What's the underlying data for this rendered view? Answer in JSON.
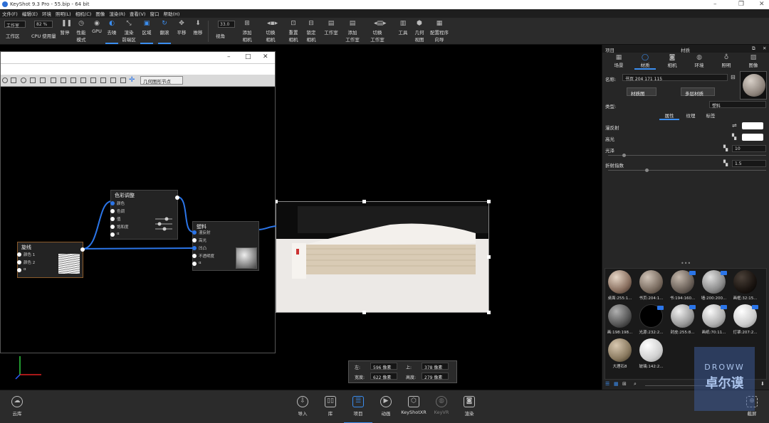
{
  "window": {
    "title": "KeyShot 9.3 Pro  -  55.bip  -  64 bit"
  },
  "menu": [
    "文件(F)",
    "编辑(E)",
    "环境",
    "照明(L)",
    "相机(C)",
    "图像",
    "渲染(R)",
    "查看(V)",
    "窗口",
    "帮助(H)"
  ],
  "toolbar": {
    "workspace_value": "工作室",
    "workspace_label": "工作区",
    "cpu_value": "82 %",
    "cpu_label": "CPU 使用量",
    "pause": "暂停",
    "perf_mode": "性能\n模式",
    "gpu": "GPU",
    "denoise": "去噪",
    "region": "渲染\n前端区",
    "area": "区域",
    "tumble": "翻滚",
    "pan": "平移",
    "dolly": "推移",
    "fov_value": "33.0",
    "perspective": "视角",
    "add_camera": "添加\n相机",
    "switch_camera": "切换\n相机",
    "reset_camera": "重置\n相机",
    "lock_camera": "锁定\n相机",
    "studio": "工作室",
    "add_studio": "添加\n工作室",
    "switch_studio": "切换\n工作室",
    "tools": "工具",
    "geometry_view": "几何\n视图",
    "configurator": "配置程序\n向导"
  },
  "graph": {
    "node_button": "几何图形节点",
    "nodes": {
      "color_adjust": {
        "title": "色彩调整",
        "ports": [
          "颜色",
          "色调",
          "值",
          "饱和度",
          "α"
        ]
      },
      "cloud": {
        "title": "旋线",
        "ports": [
          "颜色 1",
          "颜色 2",
          "α"
        ]
      },
      "plastic": {
        "title": "塑料",
        "ports": [
          "漫反射",
          "高光",
          "凹凸",
          "不透明度",
          "α"
        ]
      }
    }
  },
  "info": {
    "left_label": "左:",
    "left_value": "596 像素",
    "top_label": "上:",
    "top_value": "378 像素",
    "width_label": "宽度:",
    "width_value": "622 像素",
    "height_label": "高度:",
    "height_value": "279 像素"
  },
  "panel": {
    "project": "项目",
    "material": "材质",
    "tabs": [
      "场景",
      "材质",
      "相机",
      "环境",
      "照明",
      "图像"
    ],
    "name_label": "名称:",
    "name_value": "书页 204 171 115",
    "material_graph_button": "材质图",
    "multilayer_button": "多层材质",
    "type_label": "类型:",
    "type_value": "塑料",
    "subtabs": [
      "属性",
      "纹理",
      "标签"
    ],
    "diffuse": "漫反射",
    "specular": "高光",
    "roughness": "光泽",
    "roughness_value": "10",
    "refraction": "折射指数",
    "refraction_value": "1.5"
  },
  "library": [
    {
      "label": "桌面:255:1..."
    },
    {
      "label": "书页:204:1..."
    },
    {
      "label": "书:194:160..."
    },
    {
      "label": "墙:200:200..."
    },
    {
      "label": "画框:32:15..."
    },
    {
      "label": "画:198:198..."
    },
    {
      "label": "光源:232:2..."
    },
    {
      "label": "封皮:255:8..."
    },
    {
      "label": "画纸:70:11..."
    },
    {
      "label": "灯罩:207:2..."
    },
    {
      "label": "大理石8"
    },
    {
      "label": "玻璃:142:2..."
    }
  ],
  "bottom": {
    "cloud": "云库",
    "import": "导入",
    "library": "库",
    "project": "项目",
    "animation": "动画",
    "keyshotxr": "KeyShotXR",
    "keyvr": "KeyVR",
    "render": "渲染",
    "screenshot": "截屏"
  },
  "watermark": {
    "brand": "DROWW",
    "text": "卓尔谟"
  },
  "colors": {
    "accent": "#3b8ef0",
    "wire": "#2b75e8"
  }
}
